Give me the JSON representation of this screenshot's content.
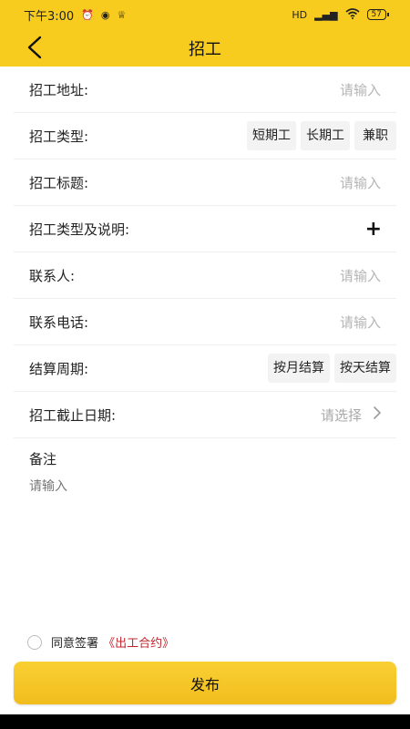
{
  "status": {
    "time": "下午3:00",
    "icons": [
      "alarm-icon",
      "eye-icon",
      "notification-icon"
    ],
    "signal": "HD",
    "battery": "57"
  },
  "nav": {
    "title": "招工"
  },
  "form": {
    "address": {
      "label": "招工地址:",
      "placeholder": "请输入"
    },
    "job_type": {
      "label": "招工类型:",
      "options": [
        "短期工",
        "长期工",
        "兼职"
      ]
    },
    "job_title": {
      "label": "招工标题:",
      "placeholder": "请输入"
    },
    "type_desc": {
      "label": "招工类型及说明:"
    },
    "contact": {
      "label": "联系人:",
      "placeholder": "请输入"
    },
    "phone": {
      "label": "联系电话:",
      "placeholder": "请输入"
    },
    "settlement": {
      "label": "结算周期:",
      "options": [
        "按月结算",
        "按天结算"
      ]
    },
    "deadline": {
      "label": "招工截止日期:",
      "value": "请选择"
    }
  },
  "remarks": {
    "title": "备注",
    "placeholder": "请输入"
  },
  "agreement": {
    "text": "同意签署",
    "link": "《出工合约》",
    "checked": false
  },
  "publish_label": "发布",
  "colors": {
    "accent": "#f8cc1f",
    "link": "#c0272d"
  }
}
